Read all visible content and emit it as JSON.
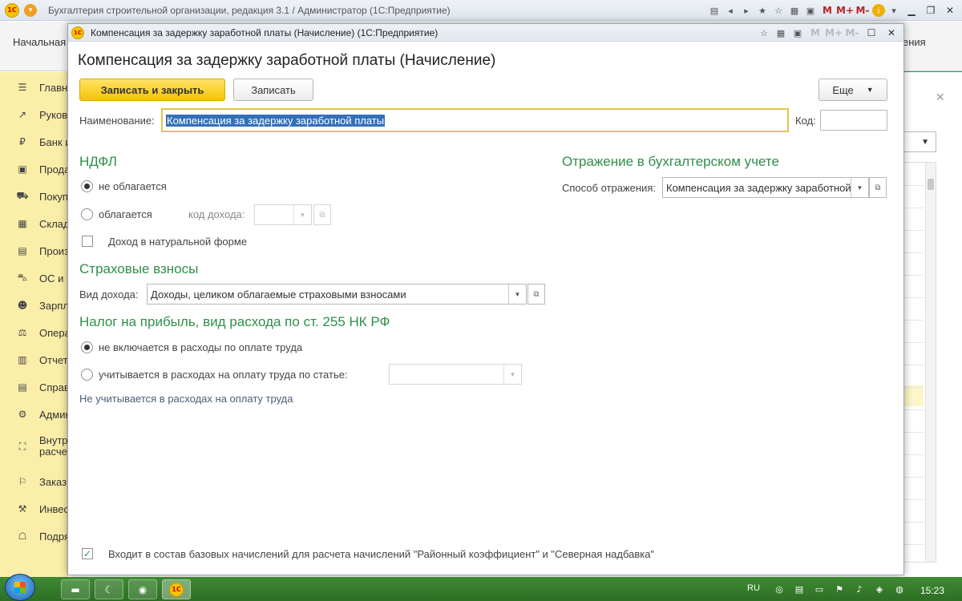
{
  "app": {
    "title": "Бухгалтерия строительной организации, редакция 3.1 / Администратор  (1С:Предприятие)",
    "logo_text": "1С",
    "tools": [
      "Избранное",
      "История",
      "Калькулятор",
      "Календарь",
      "M",
      "M+",
      "M-"
    ],
    "m_labels": [
      "M",
      "M+",
      "M-"
    ],
    "info_icon_text": "i"
  },
  "background": {
    "left_tab": "Начальная",
    "right_tab": "ения",
    "accent_color": "#2a9d6e"
  },
  "sidebar": {
    "items": [
      {
        "icon": "menu-icon",
        "glyph": "☰",
        "label": "Главное"
      },
      {
        "icon": "chart-icon",
        "glyph": "↗",
        "label": "Руководителю"
      },
      {
        "icon": "bank-icon",
        "glyph": "₽",
        "label": "Банк и касса"
      },
      {
        "icon": "sales-icon",
        "glyph": "▣",
        "label": "Продажи"
      },
      {
        "icon": "cart-icon",
        "glyph": "⛟",
        "label": "Покупки"
      },
      {
        "icon": "warehouse-icon",
        "glyph": "▦",
        "label": "Склад"
      },
      {
        "icon": "production-icon",
        "glyph": "▤",
        "label": "Производство"
      },
      {
        "icon": "assets-icon",
        "glyph": "⛍",
        "label": "ОС и НМА"
      },
      {
        "icon": "salary-icon",
        "glyph": "☻",
        "label": "Зарплата и кадры"
      },
      {
        "icon": "operations-icon",
        "glyph": "⚖",
        "label": "Операции"
      },
      {
        "icon": "reports-icon",
        "glyph": "▥",
        "label": "Отчеты"
      },
      {
        "icon": "reference-icon",
        "glyph": "▤",
        "label": "Справочники"
      },
      {
        "icon": "admin-icon",
        "glyph": "⚙",
        "label": "Администрирование"
      },
      {
        "icon": "internal-icon",
        "glyph": "⛶",
        "label": "Внутренние расчеты",
        "two_line": true,
        "line1": "Внутр",
        "line2": "расче"
      },
      {
        "icon": "orders-icon",
        "glyph": "⚐",
        "label": "Заказы"
      },
      {
        "icon": "investment-icon",
        "glyph": "⚒",
        "label": "Инвестиции"
      },
      {
        "icon": "contracts-icon",
        "glyph": "☖",
        "label": "Подряды"
      }
    ]
  },
  "modal": {
    "window_title": "Компенсация за задержку заработной платы (Начисление)  (1С:Предприятие)",
    "form_title": "Компенсация за задержку заработной платы (Начисление)",
    "buttons": {
      "save_close": "Записать и закрыть",
      "save": "Записать",
      "more": "Еще"
    },
    "name_label": "Наименование:",
    "name_value": "Компенсация за задержку заработной платы",
    "code_label": "Код:",
    "code_value": "",
    "ndfl": {
      "title": "НДФЛ",
      "not_taxed": "не облагается",
      "taxed": "облагается",
      "income_code_label": "код дохода:",
      "income_code_value": "",
      "in_kind": "Доход в натуральной форме",
      "selected": "not_taxed",
      "in_kind_checked": false
    },
    "insurance": {
      "title": "Страховые взносы",
      "income_type_label": "Вид дохода:",
      "income_type_value": "Доходы, целиком облагаемые страховыми взносами"
    },
    "profit_tax": {
      "title": "Налог на прибыль, вид расхода по ст. 255 НК РФ",
      "not_included": "не включается в расходы по оплате труда",
      "included_by_article": "учитывается в расходах на оплату труда по статье:",
      "article_value": "",
      "note": "Не учитывается в расходах на оплату труда",
      "selected": "not_included"
    },
    "accounting": {
      "title": "Отражение в бухгалтерском учете",
      "method_label": "Способ отражения:",
      "method_value": "Компенсация за задержку заработной"
    },
    "base_accruals": {
      "label": "Входит в состав базовых начислений для расчета начислений \"Районный коэффициент\" и \"Северная надбавка\"",
      "checked": true
    }
  },
  "taskbar": {
    "language": "RU",
    "time": "15:23"
  },
  "colors": {
    "primary_button": "#f5c400",
    "section_title": "#2f8f4a",
    "sidebar_bg": "#fbeea8",
    "taskbar": "#3a7f2e"
  }
}
